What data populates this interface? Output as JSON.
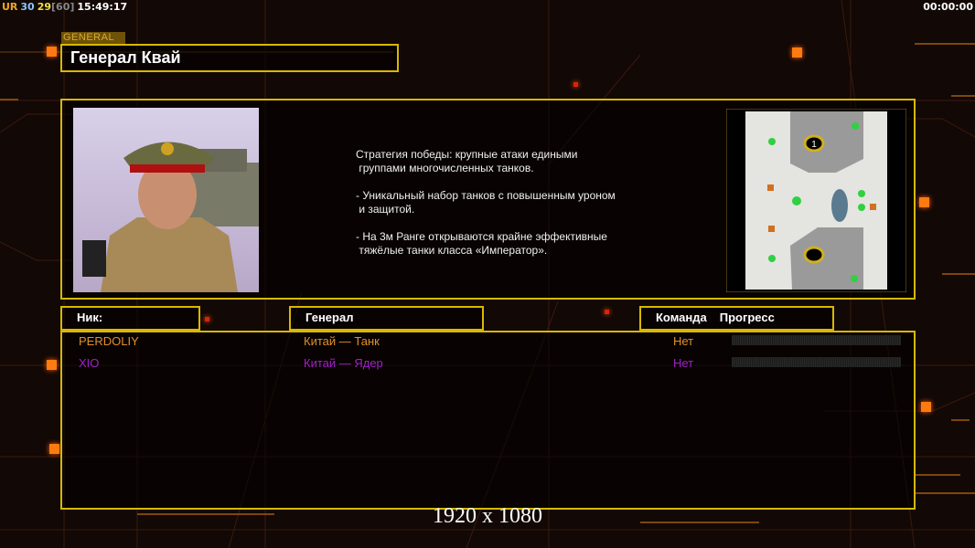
{
  "hud": {
    "ur": "UR",
    "v1": "30",
    "v2": "29",
    "v3": "[60]",
    "time": "15:49:17",
    "timer": "00:00:00"
  },
  "general": {
    "tag": "GENERAL",
    "name": "Генерал Квай",
    "description": "Стратегия победы: крупные атаки едиными\n группами многочисленных танков.\n\n- Уникальный набор танков с повышенным уроном\n и защитой.\n\n- На 3м Ранге открываются крайне эффективные\n тяжёлые танки класса «Император»."
  },
  "map": {
    "start_marker": "1"
  },
  "table": {
    "headers": {
      "nick": "Ник:",
      "general": "Генерал",
      "team": "Команда",
      "progress": "Прогресс"
    },
    "rows": [
      {
        "nick": "PERDOLIY",
        "general": "Китай — Танк",
        "team": "Нет",
        "progress": 0,
        "color": "#e0902a"
      },
      {
        "nick": "XIO",
        "general": "Китай — Ядер",
        "team": "Нет",
        "progress": 0,
        "color": "#a020c8"
      }
    ]
  },
  "resolution": "1920 x 1080",
  "colors": {
    "frame": "#d8b800",
    "accent": "#ff7a10"
  }
}
